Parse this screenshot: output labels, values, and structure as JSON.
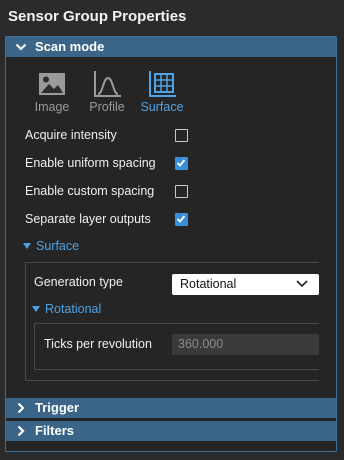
{
  "panel_title": "Sensor Group Properties",
  "sections": {
    "scan_mode": "Scan mode",
    "trigger": "Trigger",
    "filters": "Filters"
  },
  "tabs": [
    {
      "label": "Image",
      "icon": "image-icon",
      "selected": false
    },
    {
      "label": "Profile",
      "icon": "profile-icon",
      "selected": false
    },
    {
      "label": "Surface",
      "icon": "surface-icon",
      "selected": true
    }
  ],
  "options": [
    {
      "label": "Acquire intensity",
      "checked": false
    },
    {
      "label": "Enable uniform spacing",
      "checked": true
    },
    {
      "label": "Enable custom spacing",
      "checked": false
    },
    {
      "label": "Separate layer outputs",
      "checked": true
    }
  ],
  "surface": {
    "header": "Surface",
    "generation_type_label": "Generation type",
    "generation_type_value": "Rotational",
    "rotational": {
      "header": "Rotational",
      "ticks_label": "Ticks per revolution",
      "ticks_value": "360.000"
    }
  },
  "colors": {
    "accent": "#4ea3e6",
    "header_bg": "#3a6488",
    "checkbox_checked": "#3a8fd8",
    "background": "#2b2b2b"
  }
}
